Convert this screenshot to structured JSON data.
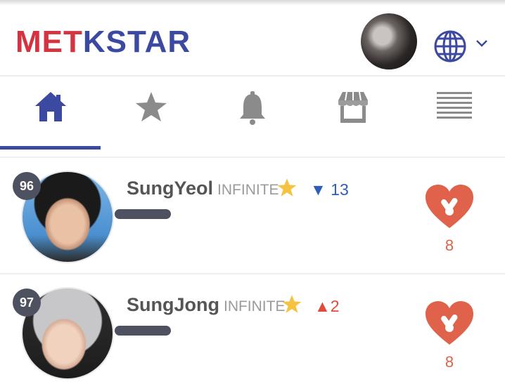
{
  "app": {
    "logo_left": "MET",
    "logo_right": "KSTAR"
  },
  "colors": {
    "brand_red": "#d43340",
    "brand_blue": "#3b4aa0",
    "heart": "#e0624a",
    "rank_bg": "#4e5160",
    "star": "#f5c242",
    "down": "#2d5fb8",
    "up": "#e04b3a"
  },
  "header": {
    "profile_icon": "user-avatar",
    "language_icon": "globe-icon",
    "menu_icon": "chevron-down-icon"
  },
  "tabs": [
    {
      "icon": "home-icon",
      "active": true
    },
    {
      "icon": "star-icon",
      "active": false
    },
    {
      "icon": "bell-icon",
      "active": false
    },
    {
      "icon": "store-icon",
      "active": false
    },
    {
      "icon": "list-icon",
      "active": false
    }
  ],
  "ranking": [
    {
      "rank": "96",
      "name": "SungYeol",
      "group": "INFINITE",
      "trend_dir": "down",
      "trend_symbol": "▼",
      "trend_value": "13",
      "hearts": "8"
    },
    {
      "rank": "97",
      "name": "SungJong",
      "group": "INFINITE",
      "trend_dir": "up",
      "trend_symbol": "▲",
      "trend_value": "2",
      "hearts": "8"
    }
  ]
}
